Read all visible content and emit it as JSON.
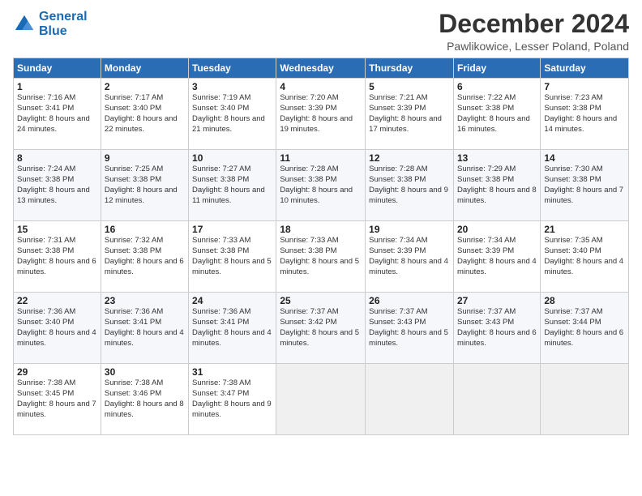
{
  "logo": {
    "line1": "General",
    "line2": "Blue"
  },
  "title": "December 2024",
  "location": "Pawlikowice, Lesser Poland, Poland",
  "days_header": [
    "Sunday",
    "Monday",
    "Tuesday",
    "Wednesday",
    "Thursday",
    "Friday",
    "Saturday"
  ],
  "weeks": [
    [
      {
        "day": "1",
        "sunrise": "7:16 AM",
        "sunset": "3:41 PM",
        "daylight": "8 hours and 24 minutes."
      },
      {
        "day": "2",
        "sunrise": "7:17 AM",
        "sunset": "3:40 PM",
        "daylight": "8 hours and 22 minutes."
      },
      {
        "day": "3",
        "sunrise": "7:19 AM",
        "sunset": "3:40 PM",
        "daylight": "8 hours and 21 minutes."
      },
      {
        "day": "4",
        "sunrise": "7:20 AM",
        "sunset": "3:39 PM",
        "daylight": "8 hours and 19 minutes."
      },
      {
        "day": "5",
        "sunrise": "7:21 AM",
        "sunset": "3:39 PM",
        "daylight": "8 hours and 17 minutes."
      },
      {
        "day": "6",
        "sunrise": "7:22 AM",
        "sunset": "3:38 PM",
        "daylight": "8 hours and 16 minutes."
      },
      {
        "day": "7",
        "sunrise": "7:23 AM",
        "sunset": "3:38 PM",
        "daylight": "8 hours and 14 minutes."
      }
    ],
    [
      {
        "day": "8",
        "sunrise": "7:24 AM",
        "sunset": "3:38 PM",
        "daylight": "8 hours and 13 minutes."
      },
      {
        "day": "9",
        "sunrise": "7:25 AM",
        "sunset": "3:38 PM",
        "daylight": "8 hours and 12 minutes."
      },
      {
        "day": "10",
        "sunrise": "7:27 AM",
        "sunset": "3:38 PM",
        "daylight": "8 hours and 11 minutes."
      },
      {
        "day": "11",
        "sunrise": "7:28 AM",
        "sunset": "3:38 PM",
        "daylight": "8 hours and 10 minutes."
      },
      {
        "day": "12",
        "sunrise": "7:28 AM",
        "sunset": "3:38 PM",
        "daylight": "8 hours and 9 minutes."
      },
      {
        "day": "13",
        "sunrise": "7:29 AM",
        "sunset": "3:38 PM",
        "daylight": "8 hours and 8 minutes."
      },
      {
        "day": "14",
        "sunrise": "7:30 AM",
        "sunset": "3:38 PM",
        "daylight": "8 hours and 7 minutes."
      }
    ],
    [
      {
        "day": "15",
        "sunrise": "7:31 AM",
        "sunset": "3:38 PM",
        "daylight": "8 hours and 6 minutes."
      },
      {
        "day": "16",
        "sunrise": "7:32 AM",
        "sunset": "3:38 PM",
        "daylight": "8 hours and 6 minutes."
      },
      {
        "day": "17",
        "sunrise": "7:33 AM",
        "sunset": "3:38 PM",
        "daylight": "8 hours and 5 minutes."
      },
      {
        "day": "18",
        "sunrise": "7:33 AM",
        "sunset": "3:38 PM",
        "daylight": "8 hours and 5 minutes."
      },
      {
        "day": "19",
        "sunrise": "7:34 AM",
        "sunset": "3:39 PM",
        "daylight": "8 hours and 4 minutes."
      },
      {
        "day": "20",
        "sunrise": "7:34 AM",
        "sunset": "3:39 PM",
        "daylight": "8 hours and 4 minutes."
      },
      {
        "day": "21",
        "sunrise": "7:35 AM",
        "sunset": "3:40 PM",
        "daylight": "8 hours and 4 minutes."
      }
    ],
    [
      {
        "day": "22",
        "sunrise": "7:36 AM",
        "sunset": "3:40 PM",
        "daylight": "8 hours and 4 minutes."
      },
      {
        "day": "23",
        "sunrise": "7:36 AM",
        "sunset": "3:41 PM",
        "daylight": "8 hours and 4 minutes."
      },
      {
        "day": "24",
        "sunrise": "7:36 AM",
        "sunset": "3:41 PM",
        "daylight": "8 hours and 4 minutes."
      },
      {
        "day": "25",
        "sunrise": "7:37 AM",
        "sunset": "3:42 PM",
        "daylight": "8 hours and 5 minutes."
      },
      {
        "day": "26",
        "sunrise": "7:37 AM",
        "sunset": "3:43 PM",
        "daylight": "8 hours and 5 minutes."
      },
      {
        "day": "27",
        "sunrise": "7:37 AM",
        "sunset": "3:43 PM",
        "daylight": "8 hours and 6 minutes."
      },
      {
        "day": "28",
        "sunrise": "7:37 AM",
        "sunset": "3:44 PM",
        "daylight": "8 hours and 6 minutes."
      }
    ],
    [
      {
        "day": "29",
        "sunrise": "7:38 AM",
        "sunset": "3:45 PM",
        "daylight": "8 hours and 7 minutes."
      },
      {
        "day": "30",
        "sunrise": "7:38 AM",
        "sunset": "3:46 PM",
        "daylight": "8 hours and 8 minutes."
      },
      {
        "day": "31",
        "sunrise": "7:38 AM",
        "sunset": "3:47 PM",
        "daylight": "8 hours and 9 minutes."
      },
      null,
      null,
      null,
      null
    ]
  ]
}
